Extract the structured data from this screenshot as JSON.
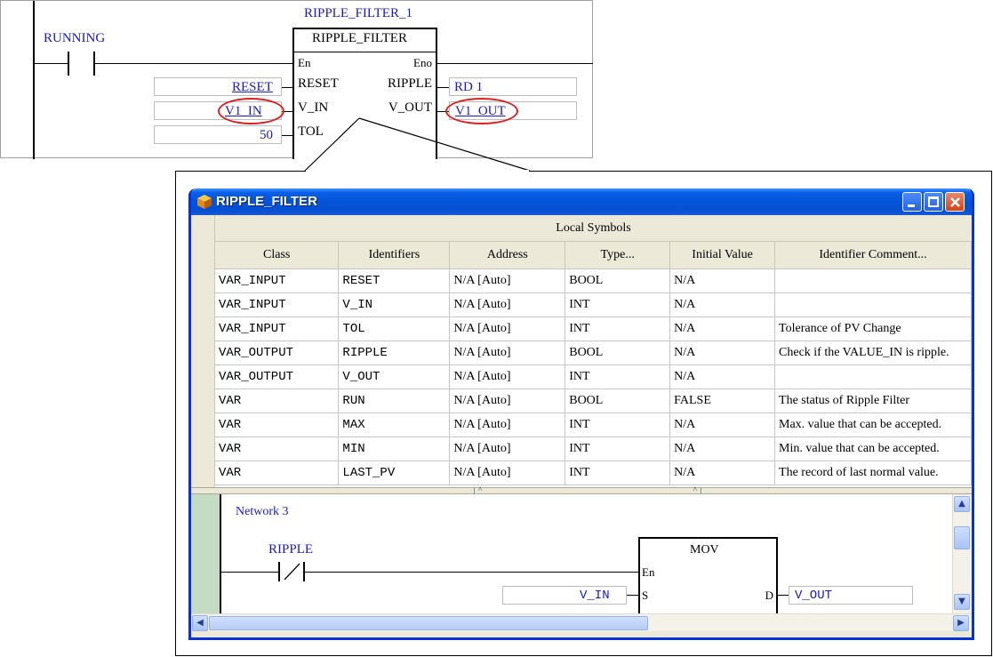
{
  "ladder": {
    "instance_name": "RIPPLE_FILTER_1",
    "block_type": "RIPPLE_FILTER",
    "contact_label": "RUNNING",
    "pin_en": "En",
    "pin_eno": "Eno",
    "inputs": [
      {
        "pin": "RESET",
        "value": "RESET"
      },
      {
        "pin": "V_IN",
        "value": "V1_IN"
      },
      {
        "pin": "TOL",
        "value": "50"
      }
    ],
    "outputs": [
      {
        "pin": "RIPPLE",
        "value": "RD 1"
      },
      {
        "pin": "V_OUT",
        "value": "V1_OUT"
      }
    ]
  },
  "window": {
    "title": "RIPPLE_FILTER",
    "section_title": "Local Symbols",
    "columns": [
      "Class",
      "Identifiers",
      "Address",
      "Type...",
      "Initial Value",
      "Identifier Comment..."
    ],
    "rows": [
      [
        "VAR_INPUT",
        "RESET",
        "N/A [Auto]",
        "BOOL",
        "N/A",
        ""
      ],
      [
        "VAR_INPUT",
        "V_IN",
        "N/A [Auto]",
        "INT",
        "N/A",
        ""
      ],
      [
        "VAR_INPUT",
        "TOL",
        "N/A [Auto]",
        "INT",
        "N/A",
        "Tolerance of PV Change"
      ],
      [
        "VAR_OUTPUT",
        "RIPPLE",
        "N/A [Auto]",
        "BOOL",
        "N/A",
        "Check if the VALUE_IN is ripple."
      ],
      [
        "VAR_OUTPUT",
        "V_OUT",
        "N/A [Auto]",
        "INT",
        "N/A",
        ""
      ],
      [
        "VAR",
        "RUN",
        "N/A [Auto]",
        "BOOL",
        "FALSE",
        "The status of Ripple Filter"
      ],
      [
        "VAR",
        "MAX",
        "N/A [Auto]",
        "INT",
        "N/A",
        "Max. value that can be accepted."
      ],
      [
        "VAR",
        "MIN",
        "N/A [Auto]",
        "INT",
        "N/A",
        "Min. value that can be accepted."
      ],
      [
        "VAR",
        "LAST_PV",
        "N/A [Auto]",
        "INT",
        "N/A",
        "The record of last normal value."
      ]
    ],
    "network": {
      "label": "Network 3",
      "contact_label": "RIPPLE",
      "block": "MOV",
      "pin_en": "En",
      "pin_s": "S",
      "pin_d": "D",
      "input_value": "V_IN",
      "output_value": "V_OUT"
    },
    "icons": {
      "title_icon": "folder-icon",
      "minimize": "minimize-icon",
      "maximize": "maximize-icon",
      "close": "close-icon"
    },
    "colors": {
      "accent_blue": "#1a1acc",
      "highlight_red": "#e02020",
      "titlebar": "#0453d6"
    }
  }
}
